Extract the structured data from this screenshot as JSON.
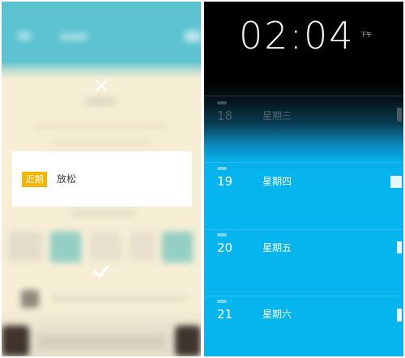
{
  "left_screen": {
    "close_icon": "close-icon",
    "confirm_icon": "check-icon",
    "card": {
      "badge": "近期",
      "text": "放松"
    },
    "colors": {
      "header": "#5dc3d1",
      "background": "#f6eed5",
      "badge": "#f4b400",
      "card": "#ffffff"
    }
  },
  "right_screen": {
    "clock": {
      "time": "02:04",
      "period": "下午"
    },
    "days": [
      {
        "date": "18",
        "weekday": "星期三"
      },
      {
        "date": "19",
        "weekday": "星期四"
      },
      {
        "date": "20",
        "weekday": "星期五"
      },
      {
        "date": "21",
        "weekday": "星期六"
      }
    ],
    "colors": {
      "top": "#000000",
      "accent": "#06b4ee",
      "text": "#ffffff"
    }
  }
}
